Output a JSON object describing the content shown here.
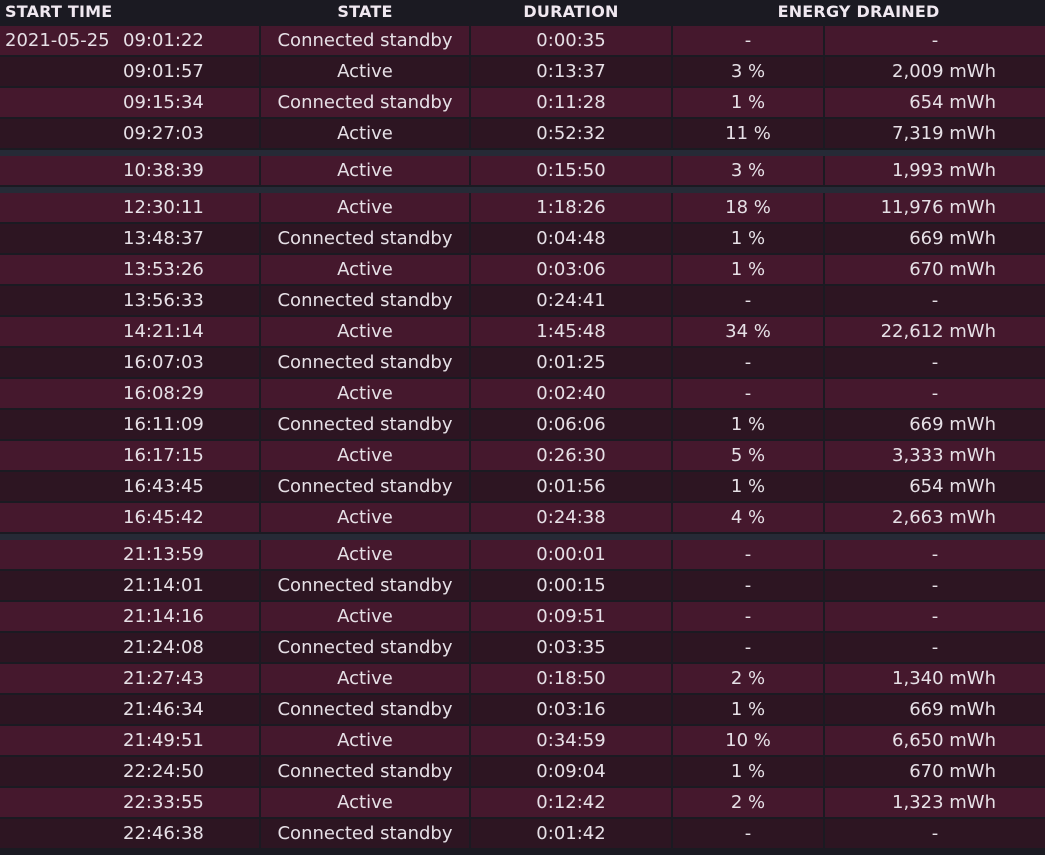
{
  "headers": {
    "start_time": "START TIME",
    "state": "STATE",
    "duration": "DURATION",
    "energy_drained": "ENERGY DRAINED"
  },
  "colors": {
    "background": "#1b1a22",
    "row_light": "#45182d",
    "row_dark": "#2d1522",
    "section_gap": "#262a36"
  },
  "rows": [
    {
      "date": "2021-05-25",
      "time": "09:01:22",
      "state": "Connected standby",
      "duration": "0:00:35",
      "percent": "-",
      "energy": "-"
    },
    {
      "time": "09:01:57",
      "state": "Active",
      "duration": "0:13:37",
      "percent": "3 %",
      "energy": "2,009 mWh"
    },
    {
      "time": "09:15:34",
      "state": "Connected standby",
      "duration": "0:11:28",
      "percent": "1 %",
      "energy": "654 mWh"
    },
    {
      "time": "09:27:03",
      "state": "Active",
      "duration": "0:52:32",
      "percent": "11 %",
      "energy": "7,319 mWh"
    },
    {
      "time": "10:38:39",
      "state": "Active",
      "duration": "0:15:50",
      "percent": "3 %",
      "energy": "1,993 mWh"
    },
    {
      "time": "12:30:11",
      "state": "Active",
      "duration": "1:18:26",
      "percent": "18 %",
      "energy": "11,976 mWh"
    },
    {
      "time": "13:48:37",
      "state": "Connected standby",
      "duration": "0:04:48",
      "percent": "1 %",
      "energy": "669 mWh"
    },
    {
      "time": "13:53:26",
      "state": "Active",
      "duration": "0:03:06",
      "percent": "1 %",
      "energy": "670 mWh"
    },
    {
      "time": "13:56:33",
      "state": "Connected standby",
      "duration": "0:24:41",
      "percent": "-",
      "energy": "-"
    },
    {
      "time": "14:21:14",
      "state": "Active",
      "duration": "1:45:48",
      "percent": "34 %",
      "energy": "22,612 mWh"
    },
    {
      "time": "16:07:03",
      "state": "Connected standby",
      "duration": "0:01:25",
      "percent": "-",
      "energy": "-"
    },
    {
      "time": "16:08:29",
      "state": "Active",
      "duration": "0:02:40",
      "percent": "-",
      "energy": "-"
    },
    {
      "time": "16:11:09",
      "state": "Connected standby",
      "duration": "0:06:06",
      "percent": "1 %",
      "energy": "669 mWh"
    },
    {
      "time": "16:17:15",
      "state": "Active",
      "duration": "0:26:30",
      "percent": "5 %",
      "energy": "3,333 mWh"
    },
    {
      "time": "16:43:45",
      "state": "Connected standby",
      "duration": "0:01:56",
      "percent": "1 %",
      "energy": "654 mWh"
    },
    {
      "time": "16:45:42",
      "state": "Active",
      "duration": "0:24:38",
      "percent": "4 %",
      "energy": "2,663 mWh"
    },
    {
      "time": "21:13:59",
      "state": "Active",
      "duration": "0:00:01",
      "percent": "-",
      "energy": "-"
    },
    {
      "time": "21:14:01",
      "state": "Connected standby",
      "duration": "0:00:15",
      "percent": "-",
      "energy": "-"
    },
    {
      "time": "21:14:16",
      "state": "Active",
      "duration": "0:09:51",
      "percent": "-",
      "energy": "-"
    },
    {
      "time": "21:24:08",
      "state": "Connected standby",
      "duration": "0:03:35",
      "percent": "-",
      "energy": "-"
    },
    {
      "time": "21:27:43",
      "state": "Active",
      "duration": "0:18:50",
      "percent": "2 %",
      "energy": "1,340 mWh"
    },
    {
      "time": "21:46:34",
      "state": "Connected standby",
      "duration": "0:03:16",
      "percent": "1 %",
      "energy": "669 mWh"
    },
    {
      "time": "21:49:51",
      "state": "Active",
      "duration": "0:34:59",
      "percent": "10 %",
      "energy": "6,650 mWh"
    },
    {
      "time": "22:24:50",
      "state": "Connected standby",
      "duration": "0:09:04",
      "percent": "1 %",
      "energy": "670 mWh"
    },
    {
      "time": "22:33:55",
      "state": "Active",
      "duration": "0:12:42",
      "percent": "2 %",
      "energy": "1,323 mWh"
    },
    {
      "time": "22:46:38",
      "state": "Connected standby",
      "duration": "0:01:42",
      "percent": "-",
      "energy": "-"
    }
  ]
}
